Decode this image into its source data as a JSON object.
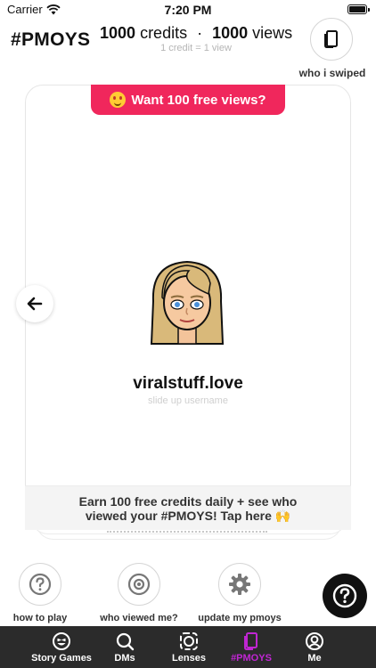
{
  "status_bar": {
    "carrier": "Carrier",
    "time": "7:20 PM"
  },
  "header": {
    "brand": "#PMOYS",
    "credits_count": "1000",
    "credits_word": "credits",
    "separator": "·",
    "views_count": "1000",
    "views_word": "views",
    "rate_note": "1 credit = 1 view",
    "swiped_label": "who i swiped"
  },
  "card": {
    "promo": "Want 100 free views?",
    "username": "viralstuff.love",
    "username_hint": "slide up username",
    "earn_banner": "Earn 100 free credits daily + see who viewed your #PMOYS! Tap here 🙌"
  },
  "quick_actions": [
    {
      "label": "how to play",
      "icon": "question-icon"
    },
    {
      "label": "who viewed me?",
      "icon": "eye-icon"
    },
    {
      "label": "update my pmoys",
      "icon": "gear-icon"
    }
  ],
  "tabbar": {
    "tabs": [
      {
        "label": "Story Games",
        "icon": "smiley-icon",
        "active": false
      },
      {
        "label": "DMs",
        "icon": "search-icon",
        "active": false
      },
      {
        "label": "Lenses",
        "icon": "lens-icon",
        "active": false
      },
      {
        "label": "#PMOYS",
        "icon": "cards-icon",
        "active": true
      },
      {
        "label": "Me",
        "icon": "profile-icon",
        "active": false
      }
    ]
  },
  "colors": {
    "promo": "#f0275c",
    "active_tab": "#c026d3",
    "tabbar": "#2b2b2b"
  }
}
